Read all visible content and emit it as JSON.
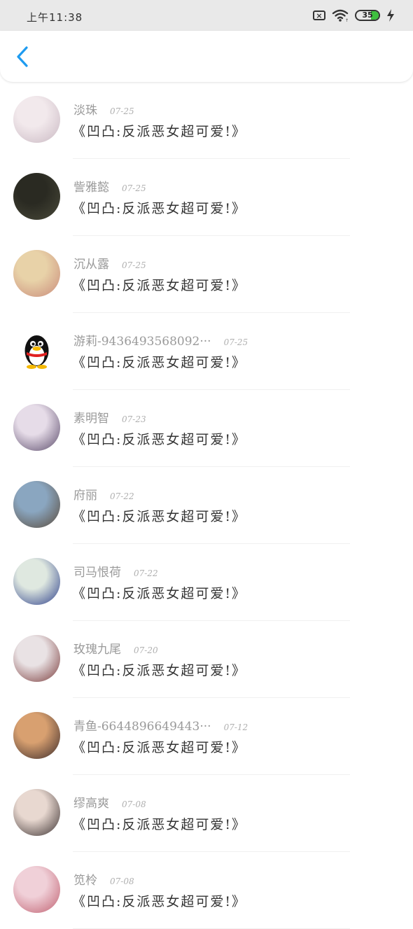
{
  "status_bar": {
    "time": "上午11:38",
    "battery_percent": 35,
    "battery_label": "35",
    "icons": [
      "close-box-icon",
      "wifi-icon",
      "battery-icon",
      "charging-bolt-icon"
    ]
  },
  "nav": {
    "back_icon": "chevron-left-icon",
    "accent_color": "#1e9bf0"
  },
  "comments": [
    {
      "name": "淡珠",
      "date": "07-25",
      "text": "《凹凸:反派恶女超可爱!》",
      "avatar_colors": [
        "#f2e9ec",
        "#c9b8c2"
      ]
    },
    {
      "name": "訾雅懿",
      "date": "07-25",
      "text": "《凹凸:反派恶女超可爱!》",
      "avatar_colors": [
        "#2a2a22",
        "#4a4a3a"
      ]
    },
    {
      "name": "沉从露",
      "date": "07-25",
      "text": "《凹凸:反派恶女超可爱!》",
      "avatar_colors": [
        "#e8d2a8",
        "#c98a7a"
      ]
    },
    {
      "name": "游莉-9436493568092···",
      "date": "07-25",
      "text": "《凹凸:反派恶女超可爱!》",
      "avatar_colors": [
        "#ffffff",
        "#000000"
      ]
    },
    {
      "name": "素明智",
      "date": "07-23",
      "text": "《凹凸:反派恶女超可爱!》",
      "avatar_colors": [
        "#e6dce8",
        "#5a4a6a"
      ]
    },
    {
      "name": "府丽",
      "date": "07-22",
      "text": "《凹凸:反派恶女超可爱!》",
      "avatar_colors": [
        "#8aa6c0",
        "#5a4a3a"
      ]
    },
    {
      "name": "司马恨荷",
      "date": "07-22",
      "text": "《凹凸:反派恶女超可爱!》",
      "avatar_colors": [
        "#dfe8e0",
        "#2c3f8a"
      ]
    },
    {
      "name": "玫瑰九尾",
      "date": "07-20",
      "text": "《凹凸:反派恶女超可爱!》",
      "avatar_colors": [
        "#e9e2e4",
        "#7a3a3a"
      ]
    },
    {
      "name": "青鱼-6644896649443···",
      "date": "07-12",
      "text": "《凹凸:反派恶女超可爱!》",
      "avatar_colors": [
        "#d8a070",
        "#3a2a2a"
      ]
    },
    {
      "name": "缪高爽",
      "date": "07-08",
      "text": "《凹凸:反派恶女超可爱!》",
      "avatar_colors": [
        "#e8d8d0",
        "#3a3030"
      ]
    },
    {
      "name": "笕柃",
      "date": "07-08",
      "text": "《凹凸:反派恶女超可爱!》",
      "avatar_colors": [
        "#f0d0d8",
        "#c06070"
      ]
    }
  ]
}
